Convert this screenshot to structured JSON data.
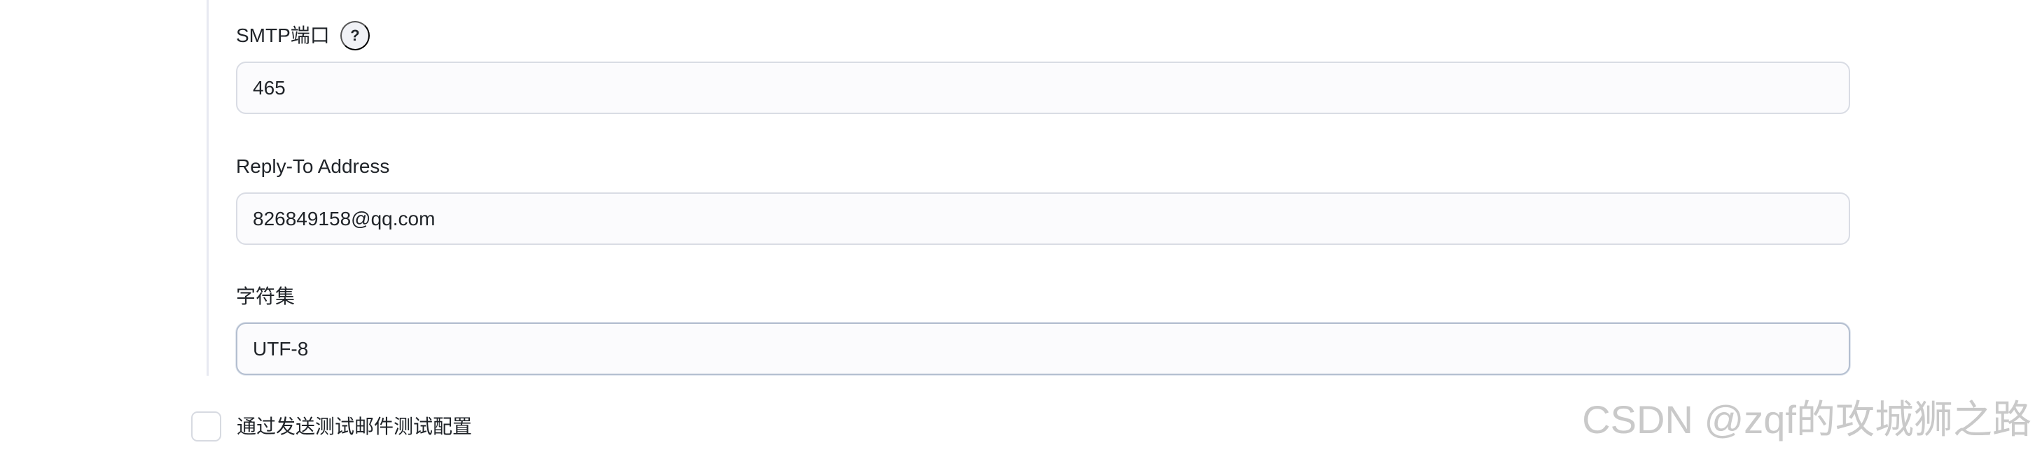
{
  "form": {
    "smtp_port": {
      "label": "SMTP端口",
      "help": "?",
      "value": "465"
    },
    "reply_to": {
      "label": "Reply-To Address",
      "value": "826849158@qq.com"
    },
    "charset": {
      "label": "字符集",
      "value": "UTF-8"
    },
    "test_config": {
      "label": "通过发送测试邮件测试配置",
      "checked": false
    }
  },
  "watermark": {
    "text": "CSDN @zqf的攻城狮之路"
  },
  "colors": {
    "input_border": "#d9dce4",
    "input_background": "#fbfbfd",
    "focused_border": "#b4bfd0",
    "section_border": "#e7e9f1",
    "watermark": "#c9c9c9"
  }
}
